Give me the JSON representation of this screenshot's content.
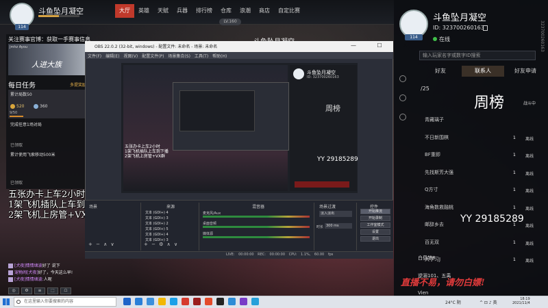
{
  "top": {
    "avatar_level": "114",
    "username": "斗鱼坠月凝空",
    "nav": [
      "大厅",
      "英雄",
      "天赋",
      "兵器",
      "排行榜",
      "仓库",
      "浪潮",
      "商店",
      "自定比赛"
    ],
    "nav_active": 0,
    "level_pill": "LV.160",
    "server_name": "斗鱼坠月凝空"
  },
  "left": {
    "notice": "关注赛事官博：获取一手赛事信息",
    "banner_sub": "Jmhz Ayou",
    "banner_title": "人进大族",
    "daily_title": "每日任务",
    "daily_more": "多提奖励",
    "task1_label": "累计局数50",
    "task1_reward1": "520",
    "task1_reward2": "360",
    "task1_progress": "9/50",
    "task2_label": "完成任意1场对局",
    "claimed1": "已领取",
    "task3_label": "累计使用飞索移动500米",
    "claimed2": "已领取"
  },
  "overlay": {
    "line1": "五张办卡上车2小时",
    "line2": "1架飞机插队上车到下播",
    "line3": "2架飞机上房管+VX群"
  },
  "chat": [
    {
      "nick": "[犬夜]情情绪波",
      "text": "好了 说下"
    },
    {
      "nick": "宠物闹[犬夜]",
      "text": "好了，今天这么早!"
    },
    {
      "nick": "[犬夜]情情绪波:",
      "text": "人呢"
    }
  ],
  "bottom_left_buttons": [
    "◎",
    "⚙",
    "≡",
    "⬚",
    "☖"
  ],
  "obs": {
    "title": "OBS 22.0.2 (32-bit, windows) - 配置文件: 未命名 - 场景: 未命名",
    "menu": [
      "文件(F)",
      "编辑(E)",
      "视图(V)",
      "配置文件(P)",
      "场景集合(S)",
      "工具(T)",
      "帮助(H)"
    ],
    "window_controls": "— ☐ ✕",
    "nested": {
      "name": "斗鱼坠月凝空",
      "id": "ID: 323700260163",
      "week": "周榜",
      "yy": "YY 29185289",
      "overlay": "五张办卡上车2小时\n1架飞机插队上车到下播\n2架飞机上房管+VX群"
    },
    "docks": {
      "scenes": "场景",
      "sources": "来源",
      "mixer": "混音器",
      "transitions": "场景过渡",
      "controls": "控件"
    },
    "sources": [
      "文本 (GDI+) 4",
      "文本 (GDI+) 3",
      "文本 (GDI+) 2",
      "文本 (GDI+) 5",
      "文本 (GDI+) 4",
      "文本 (GDI+) 3"
    ],
    "mixer": [
      {
        "label": "麦克风/Aux"
      },
      {
        "label": "桌面音频"
      },
      {
        "label": "媒体源"
      }
    ],
    "transition_name": "淡入淡出",
    "duration_label": "时长",
    "duration": "300 ms",
    "controls": [
      "开始推流",
      "开始录制",
      "工作室模式",
      "设置",
      "退出"
    ],
    "controls_active": 0,
    "scene_tools": "+ − ∧ ∨",
    "source_tools": "+ − ⚙ ∧ ∨",
    "status": "LIVE: 00:00:00   REC: 00:00:00   CPU: 1.1%, 60.00 fps"
  },
  "right": {
    "avatar_level": "114",
    "name": "斗鱼坠月凝空",
    "id": "ID: 323700260163",
    "status": "在线",
    "search_placeholder": "输入玩家名字或数字ID搜索",
    "tabs": [
      "好友",
      "联系人",
      "好友申请"
    ],
    "tab_active": 1,
    "week": "周榜",
    "rank_label": "战斗中",
    "count": "/25",
    "ranks": [
      {
        "name": "青藏璃子",
        "num": "",
        "state": ""
      },
      {
        "name": "不日新围棋",
        "num": "1",
        "state": "离线"
      },
      {
        "name": "BF重即",
        "num": "1",
        "state": "离线"
      },
      {
        "name": "先找斯芳大强",
        "num": "1",
        "state": "离线"
      },
      {
        "name": "Q方寸",
        "num": "1",
        "state": "离线"
      },
      {
        "name": "海角数救融桃",
        "num": "1",
        "state": "离线"
      },
      {
        "name": "邮辞乡去",
        "num": "1",
        "state": "离线"
      },
      {
        "name": "百无双",
        "num": "1",
        "state": "离线"
      },
      {
        "name": "大学习J",
        "num": "1",
        "state": "离线"
      }
    ],
    "yy": "YY 29185289",
    "bottom1": "白昼梦R",
    "bottom2": "逆溺101、五禹",
    "bottom3": "Vien",
    "slogan": "直播不易，请勿白嫖!",
    "edge_text": "323700260163"
  },
  "taskbar": {
    "search_placeholder": "在这里输入你要搜索的内容",
    "apps": [
      "#1e63c8",
      "#2b7fd8",
      "#3c8fdc",
      "#f2b705",
      "#1aa0e8",
      "#d63b2f",
      "#9a1e1e",
      "#e34b2b",
      "#222222",
      "#2d8cd6",
      "#7a3cc7",
      "#26a0da"
    ],
    "weather": "24°C 阴",
    "sys": "^ ⊡ ♪ 英",
    "time": "18:19",
    "date": "2021/11/4"
  }
}
